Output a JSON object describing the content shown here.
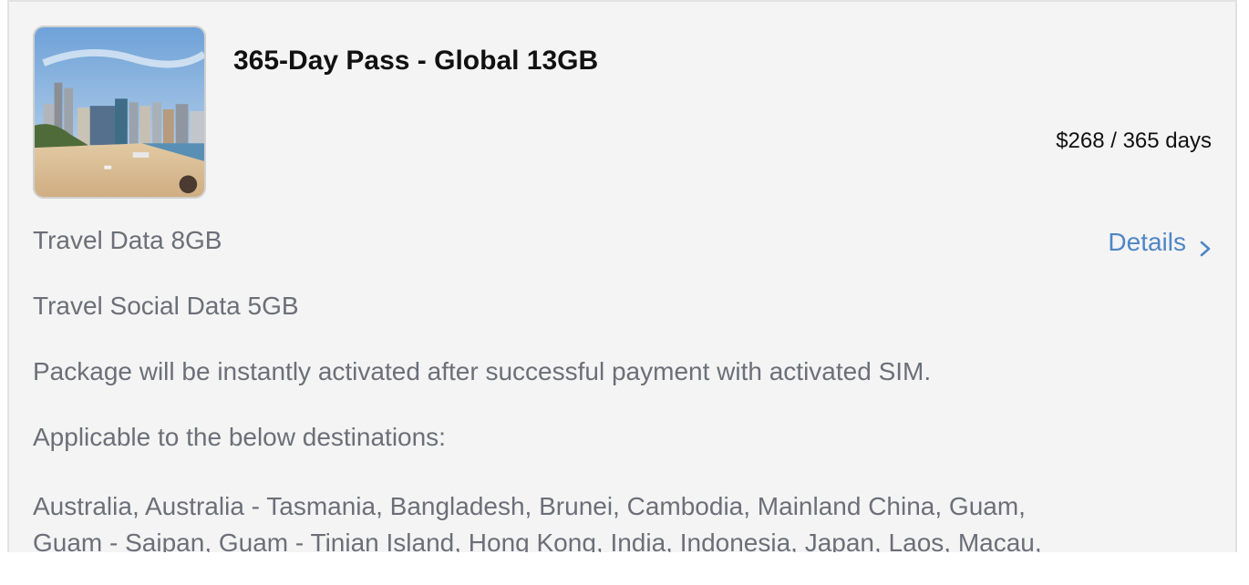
{
  "package": {
    "title": "365-Day Pass - Global 13GB",
    "price": "$268 / 365 days",
    "details_label": "Details",
    "image_name": "sydney-harbour-photo",
    "lines": [
      "Travel Data 8GB",
      "Travel Social Data 5GB",
      "Package will be instantly activated after successful payment with activated SIM.",
      "Applicable to the below destinations:"
    ],
    "destinations_line1": "Australia, Australia - Tasmania, Bangladesh, Brunei, Cambodia, Mainland China, Guam,",
    "destinations_line2": "Guam - Saipan, Guam - Tinian Island, Hong Kong, India, Indonesia, Japan, Laos, Macau,"
  },
  "colors": {
    "card_background": "#f4f4f4",
    "link": "#4f86c6",
    "body_text": "#6c6f78",
    "title_text": "#111111"
  },
  "icons": {
    "details_chevron": "chevron-right-icon"
  }
}
